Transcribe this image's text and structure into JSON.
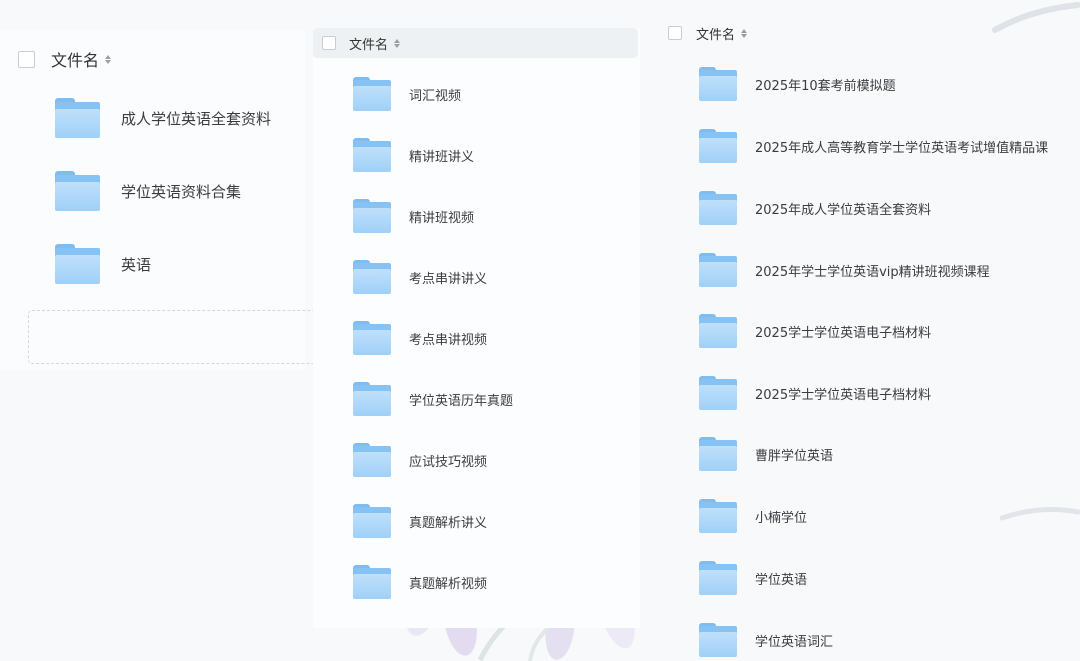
{
  "panels": [
    {
      "header": "文件名",
      "items": [
        "成人学位英语全套资料",
        "学位英语资料合集",
        "英语"
      ]
    },
    {
      "header": "文件名",
      "items": [
        "词汇视频",
        "精讲班讲义",
        "精讲班视频",
        "考点串讲讲义",
        "考点串讲视频",
        "学位英语历年真题",
        "应试技巧视频",
        "真题解析讲义",
        "真题解析视频"
      ]
    },
    {
      "header": "文件名",
      "items": [
        "2025年10套考前模拟题",
        "2025年成人高等教育学士学位英语考试增值精品课",
        "2025年成人学位英语全套资料",
        "2025年学士学位英语vip精讲班视频课程",
        "2025学士学位英语电子档材料",
        "2025学士学位英语电子档材料",
        "曹胖学位英语",
        "小楠学位",
        "学位英语",
        "学位英语词汇"
      ]
    }
  ],
  "icons": {
    "folder": "folder-icon",
    "sort": "sort-icon",
    "checkbox": "checkbox"
  },
  "colors": {
    "folder_light": "#bfe0fb",
    "folder_dark": "#7fbcf0",
    "header_bg": "#eef1f4"
  }
}
